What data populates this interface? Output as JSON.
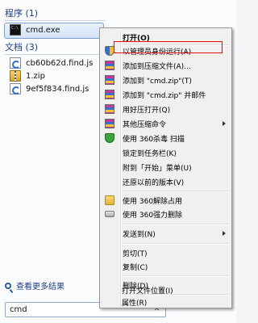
{
  "results": {
    "programs_header": "程序 (1)",
    "programs": [
      {
        "label": "cmd.exe",
        "icon": "cmd-icon"
      }
    ],
    "documents_header": "文档 (3)",
    "documents": [
      {
        "label": "cb60b62d.find.js",
        "icon": "js-file-icon"
      },
      {
        "label": "1.zip",
        "icon": "zip-file-icon"
      },
      {
        "label": "9ef5f834.find.js",
        "icon": "js-file-icon"
      }
    ],
    "more_results": "查看更多结果"
  },
  "search": {
    "value": "cmd",
    "clear_symbol": "✕"
  },
  "context_menu": {
    "open": "打开(O)",
    "run_as_admin": "以管理员身份运行(A)",
    "add_to_archive": "添加到压缩文件(A)...",
    "add_to_zip": "添加到 \"cmd.zip\"(T)",
    "add_to_zip_email": "添加到 \"cmd.zip\" 并邮件",
    "open_with_haozip": "用好压打开(Q)",
    "other_commands": "其他压缩命令",
    "scan_360": "使用 360杀毒 扫描",
    "pin_taskbar": "锁定到任务栏(K)",
    "pin_start": "附到「开始」菜单(U)",
    "restore_versions": "还原以前的版本(V)",
    "unlock_360": "使用 360解除占用",
    "force_delete_360": "使用 360强力删除",
    "send_to": "发送到(N)",
    "cut": "剪切(T)",
    "copy": "复制(C)",
    "delete": "删除(D)",
    "open_location": "打开文件位置(I)",
    "properties": "属性(R)"
  },
  "colors": {
    "highlight_border": "#ee1111",
    "header_text": "#1e3d8f"
  }
}
